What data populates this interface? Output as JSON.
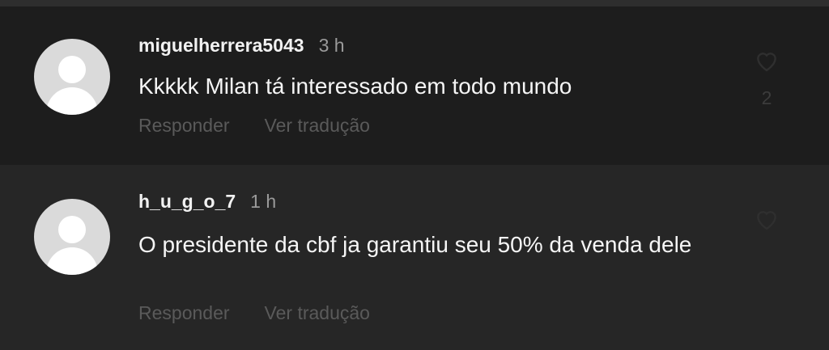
{
  "comments": [
    {
      "username": "miguelherrera5043",
      "time": "3 h",
      "text": "Kkkkk Milan tá interessado em todo mundo",
      "reply_label": "Responder",
      "translate_label": "Ver tradução",
      "like_count": "2"
    },
    {
      "username": "h_u_g_o_7",
      "time": "1 h",
      "text": "O presidente da cbf ja garantiu seu 50% da venda dele",
      "reply_label": "Responder",
      "translate_label": "Ver tradução",
      "like_count": ""
    }
  ],
  "icons": {
    "avatar": "default-avatar-icon",
    "like": "heart-icon"
  },
  "colors": {
    "background": "#262626",
    "first_comment_background": "#1d1d1d",
    "text": "#f5f5f5",
    "muted": "#5a5a5a"
  }
}
